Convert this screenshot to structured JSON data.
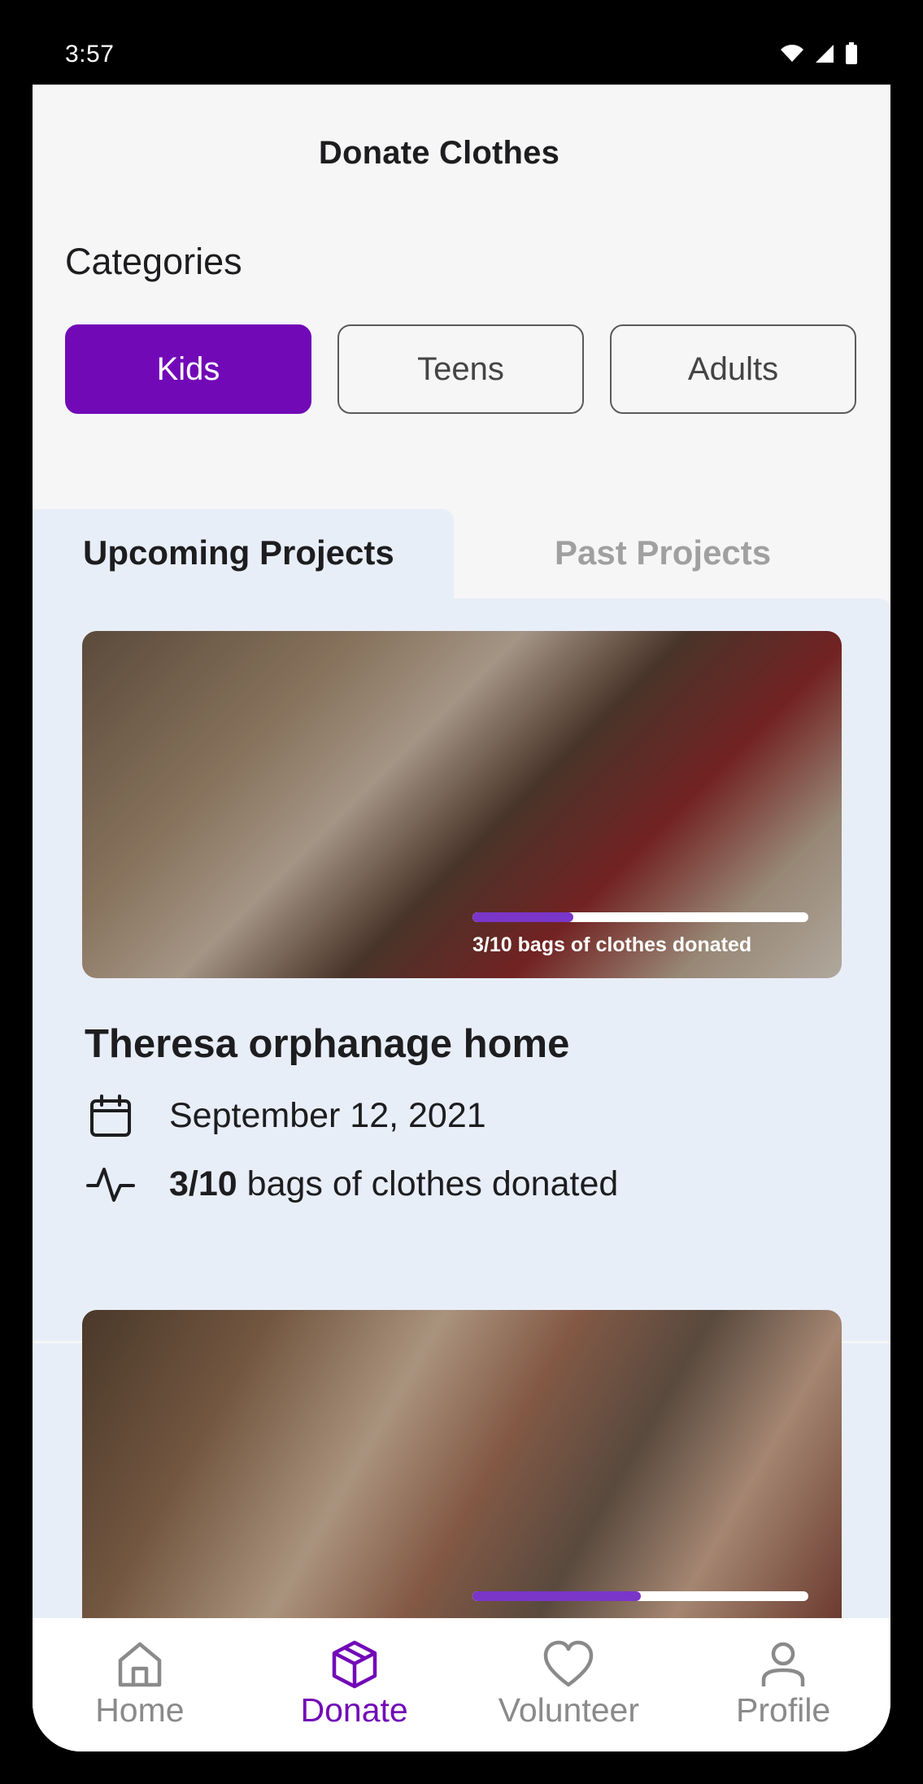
{
  "status_bar": {
    "time": "3:57"
  },
  "page": {
    "title": "Donate Clothes"
  },
  "categories": {
    "label": "Categories",
    "items": [
      "Kids",
      "Teens",
      "Adults"
    ],
    "selected": "Kids"
  },
  "tabs": {
    "upcoming": "Upcoming Projects",
    "past": "Past Projects",
    "active": "Upcoming Projects"
  },
  "projects": [
    {
      "title": "Theresa orphanage home",
      "date": "September 12, 2021",
      "donated_count": "3/10",
      "donated_suffix": " bags of clothes donated",
      "overlay_text": "3/10 bags of clothes donated",
      "progress": 0.3,
      "image": "children-writing-at-table"
    },
    {
      "progress": 0.5,
      "image": "smiling-children-group"
    }
  ],
  "nav": {
    "items": [
      {
        "label": "Home",
        "icon": "home-icon"
      },
      {
        "label": "Donate",
        "icon": "box-icon"
      },
      {
        "label": "Volunteer",
        "icon": "heart-icon"
      },
      {
        "label": "Profile",
        "icon": "person-icon"
      }
    ],
    "active": "Donate"
  },
  "colors": {
    "accent": "#7209b7",
    "progress_fill": "#7a35c9",
    "content_bg": "#e8eef8",
    "page_bg": "#f6f6f7"
  }
}
